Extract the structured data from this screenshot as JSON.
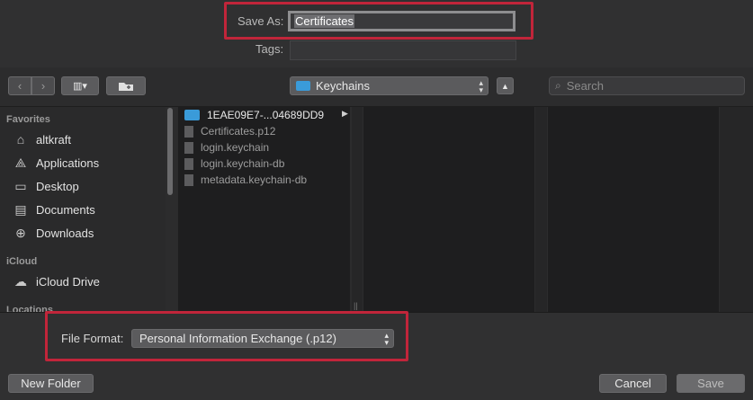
{
  "save": {
    "save_as_label": "Save As:",
    "filename": "Certificates",
    "tags_label": "Tags:"
  },
  "toolbar": {
    "location": "Keychains",
    "search_placeholder": "Search"
  },
  "sidebar": {
    "favorites_heading": "Favorites",
    "favorites": [
      {
        "label": "altkraft",
        "icon": "home-icon"
      },
      {
        "label": "Applications",
        "icon": "applications-icon"
      },
      {
        "label": "Desktop",
        "icon": "desktop-icon"
      },
      {
        "label": "Documents",
        "icon": "documents-icon"
      },
      {
        "label": "Downloads",
        "icon": "downloads-icon"
      }
    ],
    "icloud_heading": "iCloud",
    "icloud": [
      {
        "label": "iCloud Drive",
        "icon": "cloud-icon"
      }
    ],
    "locations_heading": "Locations"
  },
  "files": [
    {
      "name": "1EAE09E7-...04689DD9",
      "type": "folder"
    },
    {
      "name": "Certificates.p12",
      "type": "file"
    },
    {
      "name": "login.keychain",
      "type": "file"
    },
    {
      "name": "login.keychain-db",
      "type": "file"
    },
    {
      "name": "metadata.keychain-db",
      "type": "file"
    }
  ],
  "bottom": {
    "file_format_label": "File Format:",
    "file_format_value": "Personal Information Exchange (.p12)",
    "new_folder": "New Folder",
    "cancel": "Cancel",
    "save": "Save"
  },
  "colors": {
    "highlight": "#c1253a",
    "folder_blue": "#3a9bd9"
  }
}
